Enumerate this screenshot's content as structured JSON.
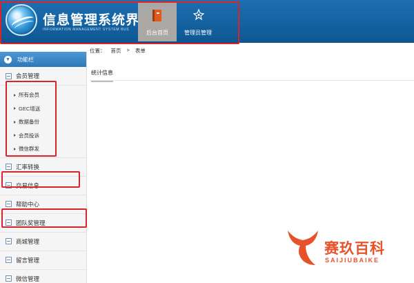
{
  "header": {
    "title": "信息管理系统界面",
    "subtitle": "INFORMATION MANAGEMENT SYSTEM BUS",
    "tabs": [
      {
        "label": "后台首页",
        "icon": "book-icon"
      },
      {
        "label": "管理员管理",
        "icon": "gear-icon"
      }
    ]
  },
  "sidebar": {
    "header": "功能栏",
    "sections": [
      {
        "label": "会员管理",
        "items": [
          "所有会员",
          "GEC增送",
          "数据备份",
          "会员投诉",
          "微信群发"
        ]
      },
      {
        "label": "汇率转换"
      },
      {
        "label": "交易信息"
      },
      {
        "label": "帮助中心"
      },
      {
        "label": "团队奖管理"
      },
      {
        "label": "商城管理"
      },
      {
        "label": "留言管理"
      },
      {
        "label": "微信管理"
      }
    ]
  },
  "breadcrumb": {
    "prefix": "位置：",
    "home": "首页",
    "separator": ">",
    "current": "表单"
  },
  "panel": {
    "tab": "统计信息"
  },
  "watermark": {
    "text": "赛玖百科",
    "sub": "SAIJIUBAIKE"
  },
  "colors": {
    "header": "#1466a8",
    "active_tab": "#aaa8a4",
    "annotation": "#d9242b",
    "watermark": "#e7522b"
  }
}
